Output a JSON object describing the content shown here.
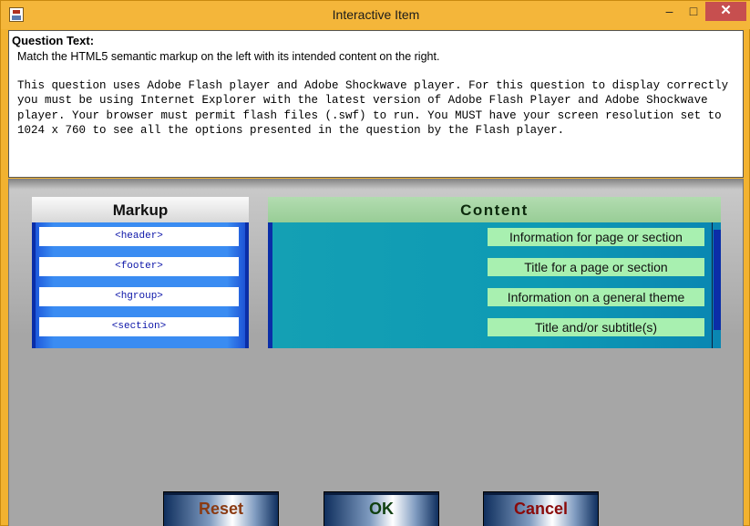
{
  "window": {
    "title": "Interactive Item",
    "minimize_label": "–",
    "maximize_label": "□",
    "close_label": "✕"
  },
  "question": {
    "label": "Question Text:",
    "intro": "Match the HTML5 semantic markup on the left with its intended content on the right.",
    "body": "This question uses Adobe Flash player and Adobe Shockwave player. For this question to display correctly you must be using Internet Explorer with the latest version of Adobe Flash Player and Adobe Shockwave player. Your browser must permit flash files (.swf) to run. You MUST have your screen resolution set to 1024 x 760 to see all the options presented in the question by the Flash player."
  },
  "markup": {
    "title": "Markup",
    "items": [
      "<header>",
      "<footer>",
      "<hgroup>",
      "<section>"
    ]
  },
  "content": {
    "title": "Content",
    "items": [
      "Information for page or section",
      "Title for a page or section",
      "Information on a general theme",
      "Title and/or subtitle(s)"
    ]
  },
  "buttons": {
    "reset": "Reset",
    "ok": "OK",
    "cancel": "Cancel"
  },
  "colors": {
    "window_frame": "#f2b230",
    "markup_panel": "#3a8cf2",
    "content_panel": "#0e9ab4",
    "content_item": "#a8f0b0"
  },
  "icons": {
    "app": "app-icon"
  }
}
